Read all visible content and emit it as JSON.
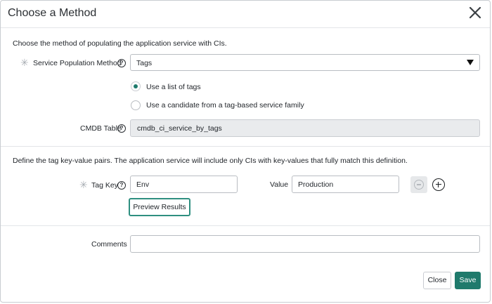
{
  "dialog": {
    "title": "Choose a Method"
  },
  "method_section": {
    "instruction": "Choose the method of populating the application service with CIs.",
    "population_method": {
      "label": "Service Population Method",
      "value": "Tags"
    },
    "radio_options": [
      {
        "label": "Use a list of tags",
        "selected": true
      },
      {
        "label": "Use a candidate from a tag-based service family",
        "selected": false
      }
    ],
    "cmdb_table": {
      "label": "CMDB Table",
      "value": "cmdb_ci_service_by_tags"
    }
  },
  "tag_section": {
    "instruction": "Define the tag key-value pairs. The application service will include only CIs with key-values that fully match this definition.",
    "tag_key_label": "Tag Key",
    "tag_key_value": "Env",
    "value_label": "Value",
    "value_value": "Production",
    "preview_label": "Preview Results"
  },
  "comments": {
    "label": "Comments",
    "value": ""
  },
  "footer": {
    "close_label": "Close",
    "save_label": "Save"
  },
  "colors": {
    "accent": "#1f7a6c",
    "focus_border": "#2e8f80",
    "readonly_bg": "#e9ebed"
  }
}
